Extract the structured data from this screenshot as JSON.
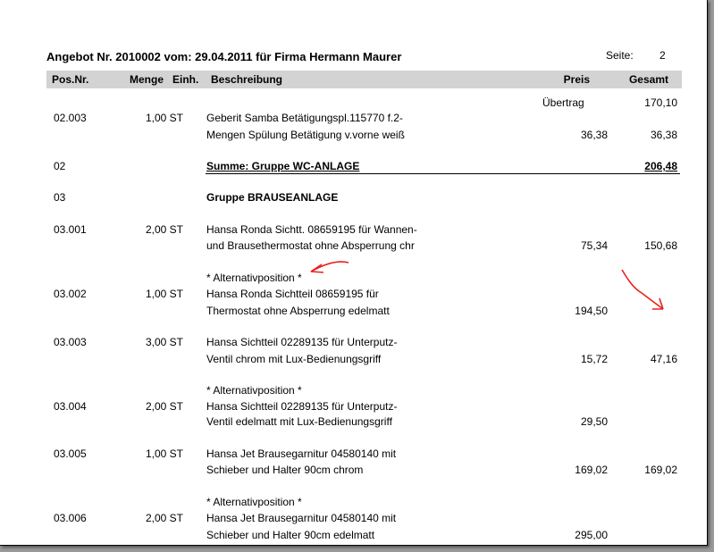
{
  "header": {
    "title": "Angebot Nr. 2010002 vom: 29.04.2011 für Firma Hermann Maurer",
    "page_label": "Seite:",
    "page_number": "2"
  },
  "columns": {
    "pos": "Pos.Nr.",
    "menge": "Menge",
    "einh": "Einh.",
    "beschreibung": "Beschreibung",
    "preis": "Preis",
    "gesamt": "Gesamt"
  },
  "uebertrag": {
    "label": "Übertrag",
    "value": "170,10"
  },
  "rows": [
    {
      "pos": "02.003",
      "menge": "1,00 ST",
      "line1": "Geberit Samba Betätigungspl.115770 f.2-",
      "line2": "Mengen Spülung Betätigung v.vorne weiß",
      "preis": "36,38",
      "gesamt": "36,38"
    },
    {
      "pos": "02",
      "sum_label": "Summe: Gruppe WC-ANLAGE",
      "sum_value": "206,48"
    },
    {
      "pos": "03",
      "group_label": "Gruppe BRAUSEANLAGE"
    },
    {
      "pos": "03.001",
      "menge": "2,00 ST",
      "line1": "Hansa Ronda Sichtt. 08659195 für Wannen-",
      "line2": "und Brausethermostat ohne Absperrung chr",
      "preis": "75,34",
      "gesamt": "150,68"
    },
    {
      "alt": "* Alternativposition *",
      "pos": "03.002",
      "menge": "1,00 ST",
      "line1": "Hansa Ronda Sichtteil 08659195 für",
      "line2": "Thermostat ohne Absperrung edelmatt",
      "preis": "194,50"
    },
    {
      "pos": "03.003",
      "menge": "3,00 ST",
      "line1": "Hansa Sichtteil 02289135 für Unterputz-",
      "line2": "Ventil chrom mit Lux-Bedienungsgriff",
      "preis": "15,72",
      "gesamt": "47,16"
    },
    {
      "alt": "* Alternativposition *",
      "pos": "03.004",
      "menge": "2,00 ST",
      "line1": "Hansa Sichtteil 02289135 für Unterputz-",
      "line2": "Ventil edelmatt mit Lux-Bedienungsgriff",
      "preis": "29,50"
    },
    {
      "pos": "03.005",
      "menge": "1,00 ST",
      "line1": "Hansa Jet Brausegarnitur 04580140 mit",
      "line2": "Schieber und Halter 90cm chrom",
      "preis": "169,02",
      "gesamt": "169,02"
    },
    {
      "alt": "* Alternativposition *",
      "pos": "03.006",
      "menge": "2,00 ST",
      "line1": "Hansa Jet Brausegarnitur 04580140 mit",
      "line2": "Schieber und Halter 90cm edelmatt",
      "preis": "295,00"
    }
  ],
  "annotation_color": "#e8201c"
}
